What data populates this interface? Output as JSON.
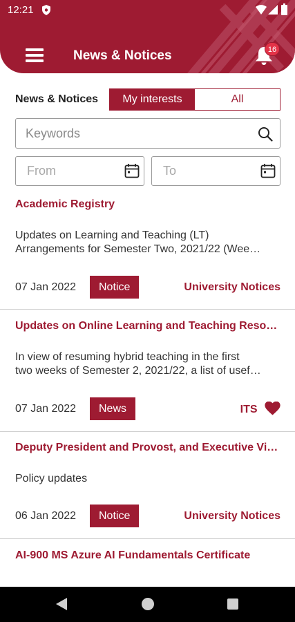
{
  "status_bar": {
    "time": "12:21"
  },
  "header": {
    "title": "News & Notices",
    "notification_count": "16"
  },
  "filters": {
    "label": "News & Notices",
    "segments": [
      "My interests",
      "All"
    ],
    "active_segment": "My interests",
    "keyword_placeholder": "Keywords",
    "from_placeholder": "From",
    "to_placeholder": "To"
  },
  "news": [
    {
      "title": "Academic Registry",
      "desc_lines": [
        "Updates on Learning and Teaching (LT)",
        "Arrangements for Semester Two, 2021/22 (Wee…"
      ],
      "date": "07 Jan 2022",
      "tag": "Notice",
      "source": "University Notices",
      "favorited": false
    },
    {
      "title": "Updates on Online Learning and Teaching Reso…",
      "desc_lines": [
        "In view of resuming hybrid teaching in the first",
        "two weeks of Semester 2, 2021/22, a list of usef…"
      ],
      "date": "07 Jan 2022",
      "tag": "News",
      "source": "ITS",
      "favorited": true
    },
    {
      "title": "Deputy President and Provost, and Executive Vi…",
      "desc_lines": [
        "Policy updates"
      ],
      "date": "06 Jan 2022",
      "tag": "Notice",
      "source": "University Notices",
      "favorited": false
    },
    {
      "title": "AI-900 MS Azure AI Fundamentals Certificate",
      "desc_lines": [],
      "date": "",
      "tag": "",
      "source": "",
      "favorited": false
    }
  ],
  "icons": {
    "menu": "menu-icon",
    "notifications": "bell-icon",
    "search": "search-icon",
    "calendar": "calendar-icon",
    "favorite": "heart-icon",
    "nav_back": "back-triangle-icon",
    "nav_home": "home-circle-icon",
    "nav_recent": "recent-square-icon"
  },
  "colors": {
    "brand": "#9e1b32",
    "badge": "#e33348",
    "text": "#333333",
    "border": "#9a9a9a",
    "divider": "#cfcfcf"
  }
}
